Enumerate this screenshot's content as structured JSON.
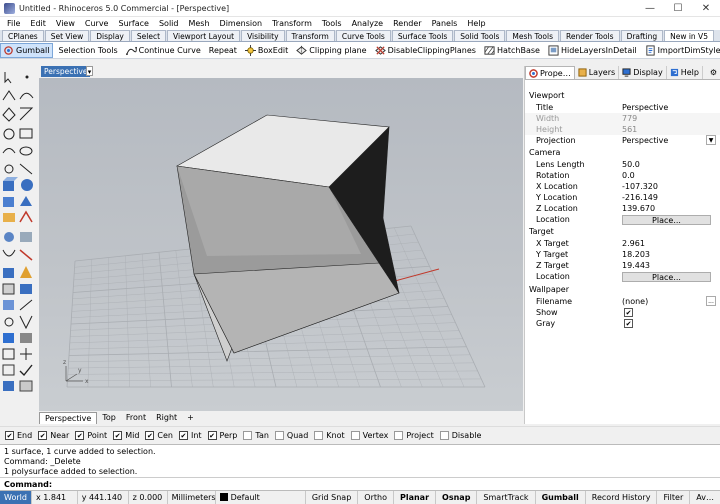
{
  "window": {
    "title": "Untitled - Rhinoceros 5.0 Commercial - [Perspective]",
    "minimize": "—",
    "maximize": "☐",
    "close": "✕"
  },
  "menu": [
    "File",
    "Edit",
    "View",
    "Curve",
    "Surface",
    "Solid",
    "Mesh",
    "Dimension",
    "Transform",
    "Tools",
    "Analyze",
    "Render",
    "Panels",
    "Help"
  ],
  "ribbon_tabs": [
    "CPlanes",
    "Set View",
    "Display",
    "Select",
    "Viewport Layout",
    "Visibility",
    "Transform",
    "Curve Tools",
    "Surface Tools",
    "Solid Tools",
    "Mesh Tools",
    "Render Tools",
    "Drafting",
    "New in V5"
  ],
  "toolbar": {
    "gumball": "Gumball",
    "selection_tools": "Selection Tools",
    "continue_curve": "Continue Curve",
    "repeat": "Repeat",
    "boxedit": "BoxEdit",
    "clipping_plane": "Clipping plane",
    "disable_clipping": "DisableClippingPlanes",
    "hatchbase": "HatchBase",
    "hide_layers": "HideLayersInDetail",
    "import_dim": "ImportDimStyles"
  },
  "viewport": {
    "title": "Perspective",
    "dropdown": "▾",
    "tabs": [
      "Perspective",
      "Top",
      "Front",
      "Right"
    ],
    "add_tab": "+"
  },
  "panel": {
    "tabs": [
      "Prope…",
      "Layers",
      "Display",
      "Help"
    ],
    "sections": {
      "viewport": "Viewport",
      "camera": "Camera",
      "target": "Target",
      "wallpaper": "Wallpaper"
    },
    "viewport_rows": [
      {
        "label": "Title",
        "value": "Perspective"
      },
      {
        "label": "Width",
        "value": "779"
      },
      {
        "label": "Height",
        "value": "561"
      },
      {
        "label": "Projection",
        "value": "Perspective"
      }
    ],
    "camera_rows": [
      {
        "label": "Lens Length",
        "value": "50.0"
      },
      {
        "label": "Rotation",
        "value": "0.0"
      },
      {
        "label": "X Location",
        "value": "-107.320"
      },
      {
        "label": "Y Location",
        "value": "-216.149"
      },
      {
        "label": "Z Location",
        "value": "139.670"
      },
      {
        "label": "Location",
        "value": "Place..."
      }
    ],
    "target_rows": [
      {
        "label": "X Target",
        "value": "2.961"
      },
      {
        "label": "Y Target",
        "value": "18.203"
      },
      {
        "label": "Z Target",
        "value": "19.443"
      },
      {
        "label": "Location",
        "value": "Place..."
      }
    ],
    "wallpaper_rows": [
      {
        "label": "Filename",
        "value": "(none)",
        "button": "..."
      },
      {
        "label": "Show",
        "checked": true
      },
      {
        "label": "Gray",
        "checked": true
      }
    ]
  },
  "osnaps": [
    {
      "label": "End",
      "checked": true
    },
    {
      "label": "Near",
      "checked": true
    },
    {
      "label": "Point",
      "checked": true
    },
    {
      "label": "Mid",
      "checked": true
    },
    {
      "label": "Cen",
      "checked": true
    },
    {
      "label": "Int",
      "checked": true
    },
    {
      "label": "Perp",
      "checked": true
    },
    {
      "label": "Tan",
      "checked": false
    },
    {
      "label": "Quad",
      "checked": false
    },
    {
      "label": "Knot",
      "checked": false
    },
    {
      "label": "Vertex",
      "checked": false
    },
    {
      "label": "Project",
      "checked": false
    },
    {
      "label": "Disable",
      "checked": false
    }
  ],
  "history": [
    "1 surface, 1 curve added to selection.",
    "Command: _Delete",
    "1 polysurface added to selection."
  ],
  "command": {
    "label": "Command:",
    "value": ""
  },
  "status": {
    "cplane": "World",
    "x": "x 1.841",
    "y": "y 441.140",
    "z": "z 0.000",
    "units": "Millimeters",
    "layer": "Default",
    "buttons": [
      "Grid Snap",
      "Ortho",
      "Planar",
      "Osnap",
      "SmartTrack",
      "Gumball",
      "Record History",
      "Filter",
      "Av…"
    ]
  },
  "colors": {
    "accent": "#3b71b3",
    "viewport_bg": "#bec2c7",
    "grid": "#a9adb2",
    "x_axis": "#c0392b",
    "y_axis": "#2e8b3a"
  }
}
